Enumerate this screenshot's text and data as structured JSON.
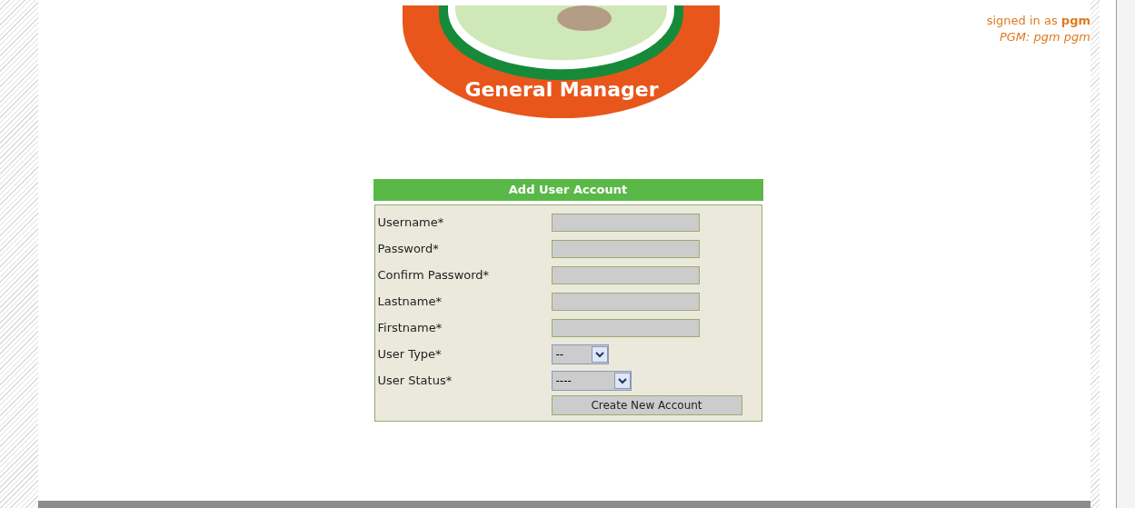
{
  "logo": {
    "caption": "General Manager"
  },
  "user": {
    "prefix": "signed in as ",
    "username": "pgm",
    "role_line": "PGM: pgm pgm"
  },
  "form": {
    "title": "Add User Account",
    "fields": [
      {
        "kind": "text",
        "label": "Username*"
      },
      {
        "kind": "text",
        "label": "Password*"
      },
      {
        "kind": "text",
        "label": "Confirm Password*"
      },
      {
        "kind": "text",
        "label": "Lastname*"
      },
      {
        "kind": "text",
        "label": "Firstname*"
      },
      {
        "kind": "select",
        "label": "User Type*",
        "value": "--"
      },
      {
        "kind": "select",
        "label": "User Status*",
        "value": "----"
      }
    ],
    "submit": "Create New Account"
  }
}
